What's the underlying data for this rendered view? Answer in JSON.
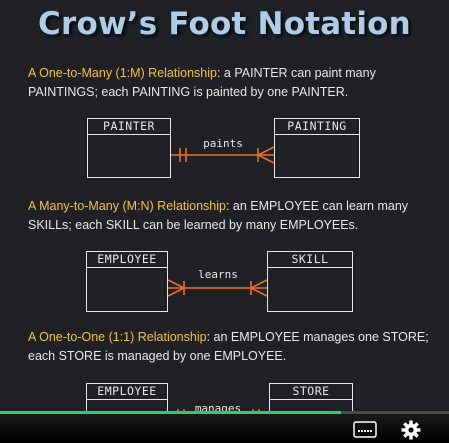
{
  "title": "Crow’s Foot Notation",
  "sections": [
    {
      "heading": "A One-to-Many (1:M) Relationship",
      "text": ": a PAINTER can paint many PAINTINGS; each PAINTING is painted by one PAINTER.",
      "left_entity": "PAINTER",
      "right_entity": "PAINTING",
      "relationship": "paints"
    },
    {
      "heading": "A Many-to-Many (M:N) Relationship",
      "text": ": an EMPLOYEE can learn many SKILLs; each SKILL can be learned by many EMPLOYEEs.",
      "left_entity": "EMPLOYEE",
      "right_entity": "SKILL",
      "relationship": "learns"
    },
    {
      "heading": "A One-to-One (1:1) Relationship",
      "text": ": an EMPLOYEE manages one STORE; each STORE is managed by one EMPLOYEE.",
      "left_entity": "EMPLOYEE",
      "right_entity": "STORE",
      "relationship": "manages"
    }
  ],
  "player": {
    "progress": 0.76,
    "icons": [
      "captions-icon",
      "settings-gear-icon"
    ]
  },
  "colors": {
    "title": "#aecbe8",
    "highlight": "#f2c14a",
    "connector": "#e8702a",
    "progress": "#2ecc71"
  }
}
